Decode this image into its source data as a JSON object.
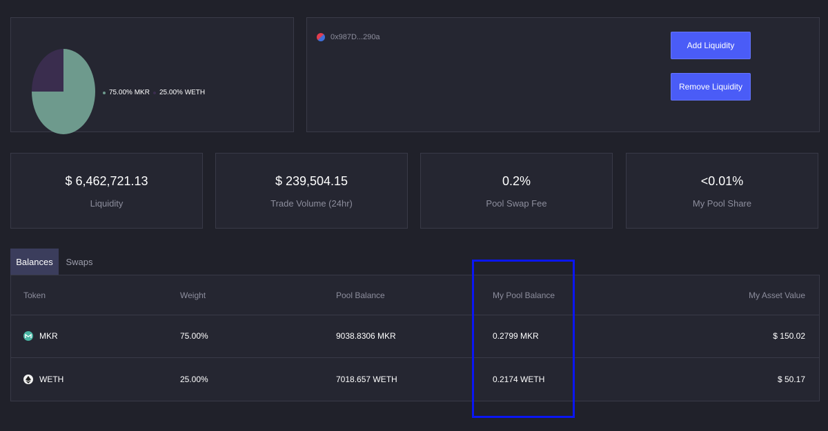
{
  "pool_chart": {
    "tokens": [
      {
        "label": "75.00% MKR",
        "percent": 75,
        "color": "#6e9a8d"
      },
      {
        "label": "25.00% WETH",
        "percent": 25,
        "color": "#3a2d4e"
      }
    ]
  },
  "pool": {
    "address": "0x987D...290a",
    "add_liquidity_label": "Add Liquidity",
    "remove_liquidity_label": "Remove Liquidity"
  },
  "stats": [
    {
      "value": "$ 6,462,721.13",
      "label": "Liquidity"
    },
    {
      "value": "$ 239,504.15",
      "label": "Trade Volume (24hr)"
    },
    {
      "value": "0.2%",
      "label": "Pool Swap Fee"
    },
    {
      "value": "<0.01%",
      "label": "My Pool Share"
    }
  ],
  "tabs": [
    {
      "label": "Balances",
      "active": true
    },
    {
      "label": "Swaps",
      "active": false
    }
  ],
  "table": {
    "headers": [
      "Token",
      "Weight",
      "Pool Balance",
      "My Pool Balance",
      "My Asset Value"
    ],
    "rows": [
      {
        "token": "MKR",
        "icon": "mkr-icon",
        "weight": "75.00%",
        "pool_balance": "9038.8306 MKR",
        "my_pool_balance": "0.2799 MKR",
        "my_asset_value": "$ 150.02"
      },
      {
        "token": "WETH",
        "icon": "weth-icon",
        "weight": "25.00%",
        "pool_balance": "7018.657 WETH",
        "my_pool_balance": "0.2174 WETH",
        "my_asset_value": "$ 50.17"
      }
    ]
  },
  "colors": {
    "accent": "#4a5cf7",
    "highlight": "#0a16f5"
  }
}
